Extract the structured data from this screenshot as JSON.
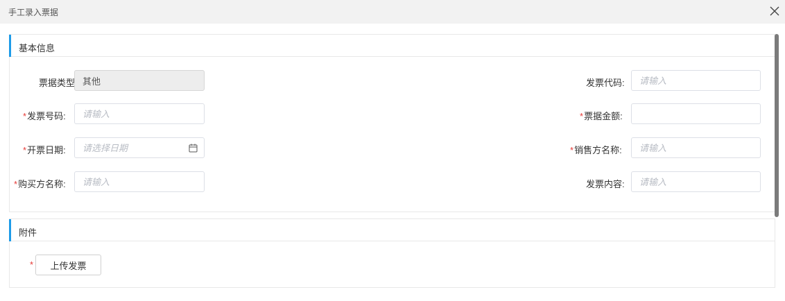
{
  "dialog": {
    "title": "手工录入票据",
    "close_icon": "close-icon"
  },
  "basic": {
    "section_title": "基本信息",
    "required_mark": "*",
    "fields": {
      "ticket_type": {
        "label": "票据类型:",
        "value": "其他"
      },
      "invoice_code": {
        "label": "发票代码:",
        "placeholder": "请输入"
      },
      "invoice_number": {
        "label": "发票号码:",
        "placeholder": "请输入"
      },
      "ticket_amount": {
        "label": "票据金额:",
        "placeholder": ""
      },
      "issue_date": {
        "label": "开票日期:",
        "placeholder": "请选择日期",
        "icon": "calendar-icon"
      },
      "seller_name": {
        "label": "销售方名称:",
        "placeholder": "请输入"
      },
      "buyer_name": {
        "label": "购买方名称:",
        "placeholder": "请输入"
      },
      "invoice_content": {
        "label": "发票内容:",
        "placeholder": "请输入"
      }
    }
  },
  "attachment": {
    "section_title": "附件",
    "required_mark": "*",
    "upload_label": "上传发票"
  },
  "colors": {
    "accent": "#1e9be8",
    "required": "#e53935"
  }
}
